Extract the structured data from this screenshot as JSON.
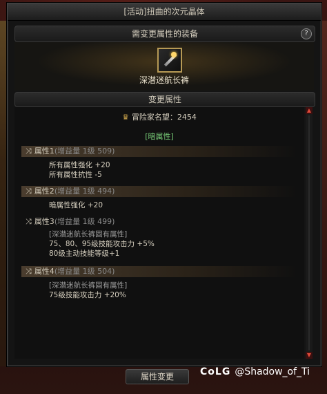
{
  "window": {
    "title": "[活动]扭曲的次元晶体"
  },
  "header": {
    "label": "需变更属性的装备",
    "help": "?"
  },
  "equipment": {
    "name": "深潜迷航长裤"
  },
  "section": {
    "label": "变更属性"
  },
  "fame": {
    "label": "冒险家名望：2454"
  },
  "element": {
    "label": "[暗属性]"
  },
  "attributes": [
    {
      "title": "属性1",
      "gain": "(增益量 1级 509)",
      "lines": [
        "所有属性强化 +20",
        "所有属性抗性 -5"
      ]
    },
    {
      "title": "属性2",
      "gain": "(增益量 1级 494)",
      "lines": [
        "暗属性强化 +20"
      ]
    },
    {
      "title": "属性3",
      "gain": "(增益量 1级 499)",
      "lines": [
        "[深潜迷航长裤固有属性]",
        "75、80、95级技能攻击力 +5%",
        "80级主动技能等级+1"
      ]
    },
    {
      "title": "属性4",
      "gain": "(增益量 1级 504)",
      "lines": [
        "[深潜迷航长裤固有属性]",
        "75级技能攻击力 +20%"
      ]
    }
  ],
  "buttons": {
    "change": "属性变更"
  },
  "watermark": {
    "logo": "CoLG",
    "handle": "@Shadow_of_Ti"
  }
}
